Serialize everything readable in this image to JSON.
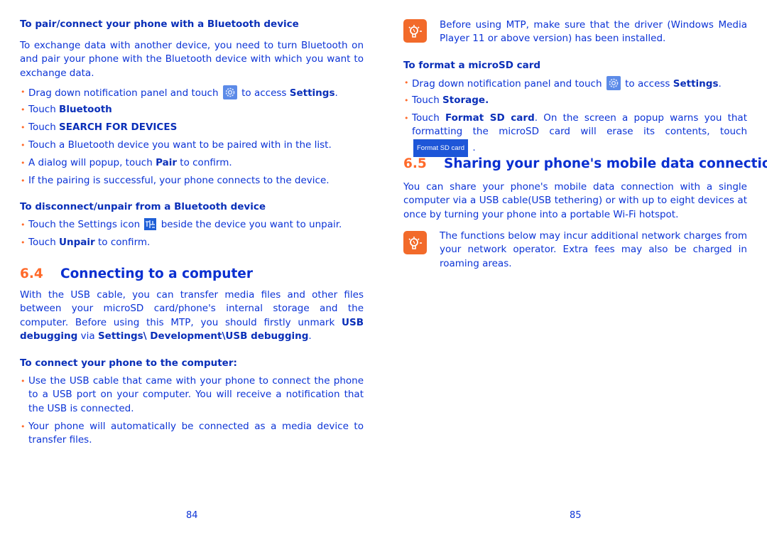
{
  "left_page": {
    "pair_heading": "To pair/connect your phone with a Bluetooth device",
    "pair_intro": "To exchange data with another device, you need to turn Bluetooth on and pair your phone with the Bluetooth device with which you want to exchange data.",
    "pair_steps": [
      {
        "pre": "Drag down notification panel and touch ",
        "icon": "settings-gear-icon",
        "mid": " to access ",
        "bold": "Settings",
        "post": "."
      },
      {
        "pre": "Touch ",
        "bold": "Bluetooth",
        "post": ""
      },
      {
        "pre": "Touch ",
        "bold": "SEARCH FOR DEVICES",
        "post": ""
      },
      {
        "text": "Touch a Bluetooth device you want to be paired with in the list."
      },
      {
        "pre": "A dialog will popup, touch ",
        "bold": "Pair",
        "post": " to confirm."
      },
      {
        "text": "If the pairing is successful, your phone connects to the device."
      }
    ],
    "unpair_heading": "To disconnect/unpair from a Bluetooth device",
    "unpair_steps": [
      {
        "pre": "Touch the Settings icon ",
        "icon": "device-settings-icon",
        "post": " beside the device you want to unpair."
      },
      {
        "pre": "Touch ",
        "bold": "Unpair",
        "post": " to confirm."
      }
    ],
    "section": {
      "number": "6.4",
      "title": "Connecting to a computer"
    },
    "usb_intro": {
      "pre": "With the USB cable, you can transfer media files and other files between your microSD card/phone's internal storage and the computer. Before using this MTP,  you should firstly unmark ",
      "bold1": "USB debugging",
      "mid": " via ",
      "bold2": "Settings\\ Development\\USB debugging",
      "post": "."
    },
    "connect_heading": "To connect your phone to the computer:",
    "connect_steps": [
      "Use the USB cable that came with your phone to connect the phone to a USB port on your computer. You will receive a notification that the USB is connected.",
      "Your phone will automatically be connected as a media device to transfer files."
    ],
    "page_number": "84"
  },
  "right_page": {
    "tip1": "Before using MTP, make sure that the driver (Windows Media Player 11 or above version) has been installed.",
    "format_heading": "To format a microSD card",
    "format_steps": [
      {
        "pre": "Drag down notification panel and touch ",
        "icon": "settings-gear-icon",
        "mid": " to access ",
        "bold": "Settings",
        "post": "."
      },
      {
        "pre": "Touch ",
        "bold": "Storage.",
        "post": ""
      },
      {
        "pre": "Touch ",
        "bold": "Format SD card",
        "post": ". On the screen a popup warns you that formatting the microSD card will erase its contents, touch ",
        "button": "Format SD card",
        "end": " ."
      }
    ],
    "section": {
      "number": "6.5",
      "title": "Sharing your phone's mobile data connection"
    },
    "share_intro": "You can share your phone's mobile data connection with a single computer via a USB cable(USB tethering) or with up to eight devices at once by turning your phone into a portable Wi-Fi hotspot.",
    "tip2": "The functions below may incur additional network charges from your network operator. Extra fees may also be charged in roaming areas.",
    "page_number": "85"
  },
  "colors": {
    "text": "#0b33d6",
    "accent": "#ff6a2a",
    "tip_icon_bg": "#f26a2a",
    "button_bg": "#1d56d8"
  }
}
